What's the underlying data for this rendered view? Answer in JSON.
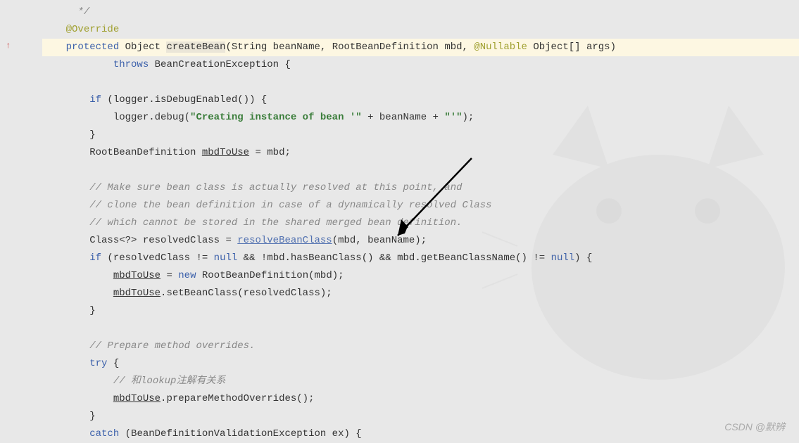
{
  "gutter": {
    "marker": "↑"
  },
  "code": {
    "l1_comment": "*/",
    "l2_annotation": "@Override",
    "l3": {
      "keyword1": "protected",
      "type1": "Object ",
      "method": "createBean",
      "params": "(String beanName, RootBeanDefinition mbd, ",
      "nullable": "@Nullable",
      "params2": " Object[] args)"
    },
    "l4": {
      "keyword": "throws",
      "rest": " BeanCreationException {"
    },
    "l6": {
      "keyword": "if",
      "rest": " (logger.isDebugEnabled()) {"
    },
    "l7": {
      "part1": "logger.debug(",
      "str1": "\"Creating instance of bean '\"",
      "part2": " + beanName + ",
      "str2": "\"'\"",
      "part3": ");"
    },
    "l8": "}",
    "l9": {
      "part1": "RootBeanDefinition ",
      "var": "mbdToUse",
      "part2": " = mbd;"
    },
    "l11_comment": "// Make sure bean class is actually resolved at this point, and",
    "l12_comment": "// clone the bean definition in case of a dynamically resolved Class",
    "l13_comment": "// which cannot be stored in the shared merged bean definition.",
    "l14": {
      "part1": "Class<?> resolvedClass = ",
      "link": "resolveBeanClass",
      "part2": "(mbd, beanName);"
    },
    "l15": {
      "keyword1": "if",
      "part1": " (resolvedClass != ",
      "keyword2": "null",
      "part2": " && !mbd.hasBeanClass() && mbd.getBeanClassName() != ",
      "keyword3": "null",
      "part3": ") {"
    },
    "l16": {
      "var": "mbdToUse",
      "part1": " = ",
      "keyword": "new",
      "part2": " RootBeanDefinition(mbd);"
    },
    "l17": {
      "var": "mbdToUse",
      "part1": ".setBeanClass(resolvedClass);"
    },
    "l18": "}",
    "l20_comment": "// Prepare method overrides.",
    "l21": {
      "keyword": "try",
      "rest": " {"
    },
    "l22_comment": "// 和lookup注解有关系",
    "l23": {
      "var": "mbdToUse",
      "rest": ".prepareMethodOverrides();"
    },
    "l24": "}",
    "l25": {
      "keyword": "catch",
      "rest": " (BeanDefinitionValidationException ex) {"
    }
  },
  "watermark": "CSDN @默辨"
}
